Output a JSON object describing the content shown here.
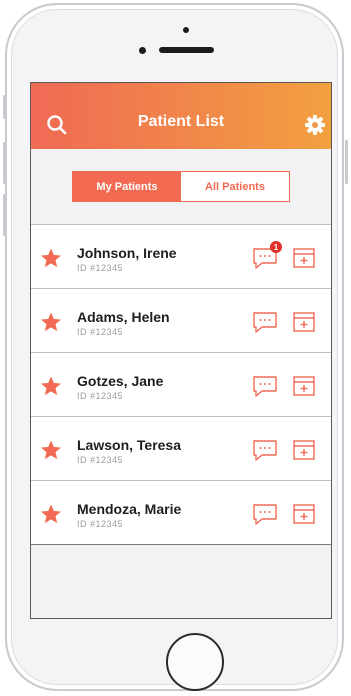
{
  "header": {
    "title": "Patient List",
    "left_icon": "search-icon",
    "right_icon": "gear-icon",
    "gradient_start": "#f06a55",
    "gradient_end": "#f2a040"
  },
  "tabs": [
    {
      "label": "My Patients",
      "active": true
    },
    {
      "label": "All Patients",
      "active": false
    }
  ],
  "patients": [
    {
      "name": "Johnson, Irene",
      "id": "ID #12345",
      "unread": "1",
      "favorite": true
    },
    {
      "name": "Adams, Helen",
      "id": "ID #12345",
      "unread": null,
      "favorite": true
    },
    {
      "name": "Gotzes, Jane",
      "id": "ID #12345",
      "unread": null,
      "favorite": true
    },
    {
      "name": "Lawson, Teresa",
      "id": "ID #12345",
      "unread": null,
      "favorite": true
    },
    {
      "name": "Mendoza, Marie",
      "id": "ID #12345",
      "unread": null,
      "favorite": true
    }
  ],
  "colors": {
    "accent": "#f26a52",
    "badge": "#e0312a"
  }
}
